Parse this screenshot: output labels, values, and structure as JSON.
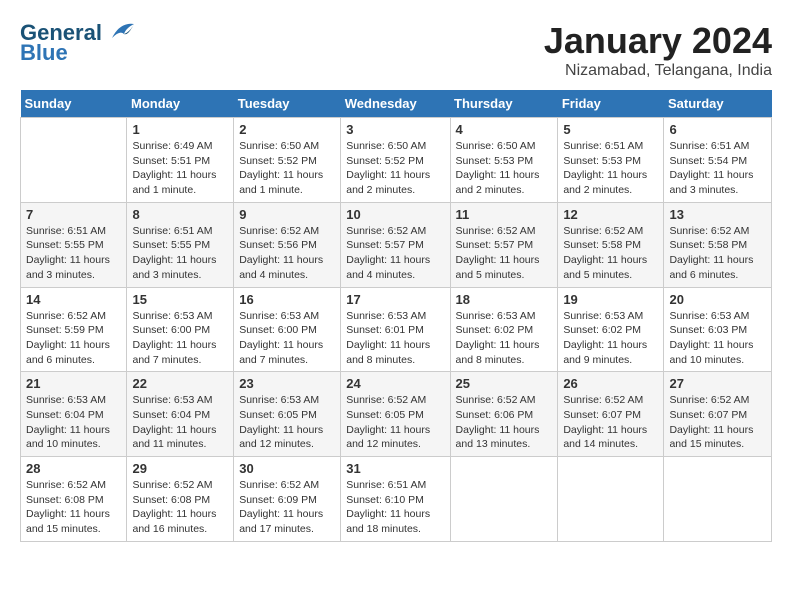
{
  "logo": {
    "line1": "General",
    "line2": "Blue"
  },
  "title": "January 2024",
  "subtitle": "Nizamabad, Telangana, India",
  "days_header": [
    "Sunday",
    "Monday",
    "Tuesday",
    "Wednesday",
    "Thursday",
    "Friday",
    "Saturday"
  ],
  "weeks": [
    [
      {
        "day": "",
        "info": ""
      },
      {
        "day": "1",
        "info": "Sunrise: 6:49 AM\nSunset: 5:51 PM\nDaylight: 11 hours\nand 1 minute."
      },
      {
        "day": "2",
        "info": "Sunrise: 6:50 AM\nSunset: 5:52 PM\nDaylight: 11 hours\nand 1 minute."
      },
      {
        "day": "3",
        "info": "Sunrise: 6:50 AM\nSunset: 5:52 PM\nDaylight: 11 hours\nand 2 minutes."
      },
      {
        "day": "4",
        "info": "Sunrise: 6:50 AM\nSunset: 5:53 PM\nDaylight: 11 hours\nand 2 minutes."
      },
      {
        "day": "5",
        "info": "Sunrise: 6:51 AM\nSunset: 5:53 PM\nDaylight: 11 hours\nand 2 minutes."
      },
      {
        "day": "6",
        "info": "Sunrise: 6:51 AM\nSunset: 5:54 PM\nDaylight: 11 hours\nand 3 minutes."
      }
    ],
    [
      {
        "day": "7",
        "info": "Sunrise: 6:51 AM\nSunset: 5:55 PM\nDaylight: 11 hours\nand 3 minutes."
      },
      {
        "day": "8",
        "info": "Sunrise: 6:51 AM\nSunset: 5:55 PM\nDaylight: 11 hours\nand 3 minutes."
      },
      {
        "day": "9",
        "info": "Sunrise: 6:52 AM\nSunset: 5:56 PM\nDaylight: 11 hours\nand 4 minutes."
      },
      {
        "day": "10",
        "info": "Sunrise: 6:52 AM\nSunset: 5:57 PM\nDaylight: 11 hours\nand 4 minutes."
      },
      {
        "day": "11",
        "info": "Sunrise: 6:52 AM\nSunset: 5:57 PM\nDaylight: 11 hours\nand 5 minutes."
      },
      {
        "day": "12",
        "info": "Sunrise: 6:52 AM\nSunset: 5:58 PM\nDaylight: 11 hours\nand 5 minutes."
      },
      {
        "day": "13",
        "info": "Sunrise: 6:52 AM\nSunset: 5:58 PM\nDaylight: 11 hours\nand 6 minutes."
      }
    ],
    [
      {
        "day": "14",
        "info": "Sunrise: 6:52 AM\nSunset: 5:59 PM\nDaylight: 11 hours\nand 6 minutes."
      },
      {
        "day": "15",
        "info": "Sunrise: 6:53 AM\nSunset: 6:00 PM\nDaylight: 11 hours\nand 7 minutes."
      },
      {
        "day": "16",
        "info": "Sunrise: 6:53 AM\nSunset: 6:00 PM\nDaylight: 11 hours\nand 7 minutes."
      },
      {
        "day": "17",
        "info": "Sunrise: 6:53 AM\nSunset: 6:01 PM\nDaylight: 11 hours\nand 8 minutes."
      },
      {
        "day": "18",
        "info": "Sunrise: 6:53 AM\nSunset: 6:02 PM\nDaylight: 11 hours\nand 8 minutes."
      },
      {
        "day": "19",
        "info": "Sunrise: 6:53 AM\nSunset: 6:02 PM\nDaylight: 11 hours\nand 9 minutes."
      },
      {
        "day": "20",
        "info": "Sunrise: 6:53 AM\nSunset: 6:03 PM\nDaylight: 11 hours\nand 10 minutes."
      }
    ],
    [
      {
        "day": "21",
        "info": "Sunrise: 6:53 AM\nSunset: 6:04 PM\nDaylight: 11 hours\nand 10 minutes."
      },
      {
        "day": "22",
        "info": "Sunrise: 6:53 AM\nSunset: 6:04 PM\nDaylight: 11 hours\nand 11 minutes."
      },
      {
        "day": "23",
        "info": "Sunrise: 6:53 AM\nSunset: 6:05 PM\nDaylight: 11 hours\nand 12 minutes."
      },
      {
        "day": "24",
        "info": "Sunrise: 6:52 AM\nSunset: 6:05 PM\nDaylight: 11 hours\nand 12 minutes."
      },
      {
        "day": "25",
        "info": "Sunrise: 6:52 AM\nSunset: 6:06 PM\nDaylight: 11 hours\nand 13 minutes."
      },
      {
        "day": "26",
        "info": "Sunrise: 6:52 AM\nSunset: 6:07 PM\nDaylight: 11 hours\nand 14 minutes."
      },
      {
        "day": "27",
        "info": "Sunrise: 6:52 AM\nSunset: 6:07 PM\nDaylight: 11 hours\nand 15 minutes."
      }
    ],
    [
      {
        "day": "28",
        "info": "Sunrise: 6:52 AM\nSunset: 6:08 PM\nDaylight: 11 hours\nand 15 minutes."
      },
      {
        "day": "29",
        "info": "Sunrise: 6:52 AM\nSunset: 6:08 PM\nDaylight: 11 hours\nand 16 minutes."
      },
      {
        "day": "30",
        "info": "Sunrise: 6:52 AM\nSunset: 6:09 PM\nDaylight: 11 hours\nand 17 minutes."
      },
      {
        "day": "31",
        "info": "Sunrise: 6:51 AM\nSunset: 6:10 PM\nDaylight: 11 hours\nand 18 minutes."
      },
      {
        "day": "",
        "info": ""
      },
      {
        "day": "",
        "info": ""
      },
      {
        "day": "",
        "info": ""
      }
    ]
  ]
}
